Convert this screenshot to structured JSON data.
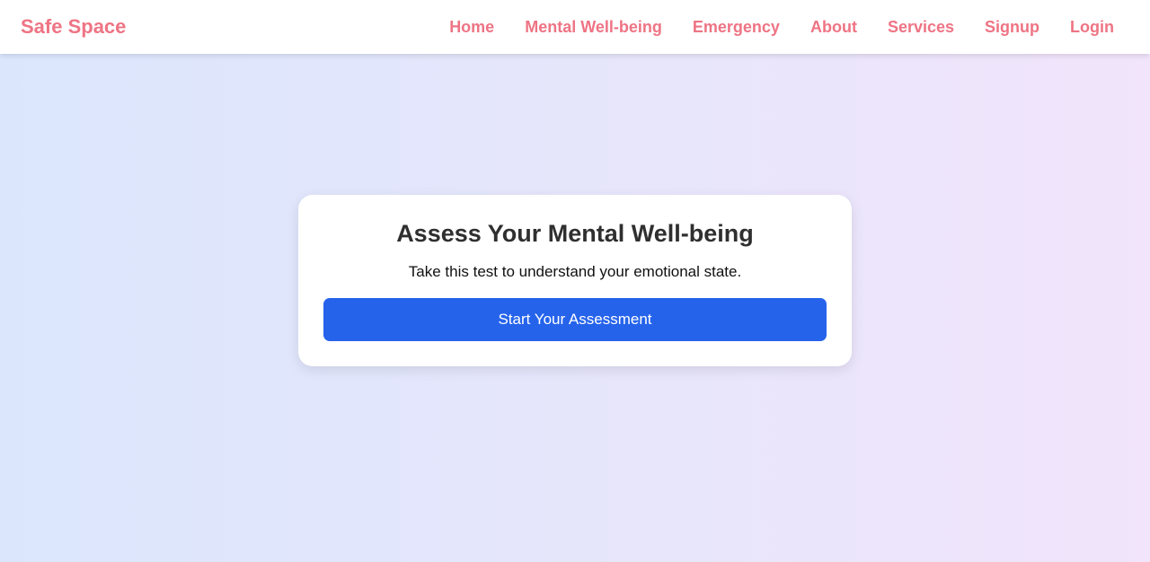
{
  "navbar": {
    "brand": "Safe Space",
    "links": [
      {
        "label": "Home"
      },
      {
        "label": "Mental Well-being"
      },
      {
        "label": "Emergency"
      },
      {
        "label": "About"
      },
      {
        "label": "Services"
      },
      {
        "label": "Signup"
      },
      {
        "label": "Login"
      }
    ]
  },
  "card": {
    "title": "Assess Your Mental Well-being",
    "subtitle": "Take this test to understand your emotional state.",
    "button_label": "Start Your Assessment"
  },
  "colors": {
    "brand_pink": "#ee7484",
    "button_blue": "#2563eb",
    "background_left": "#dbe6fd",
    "background_right": "#f1e4fb"
  }
}
